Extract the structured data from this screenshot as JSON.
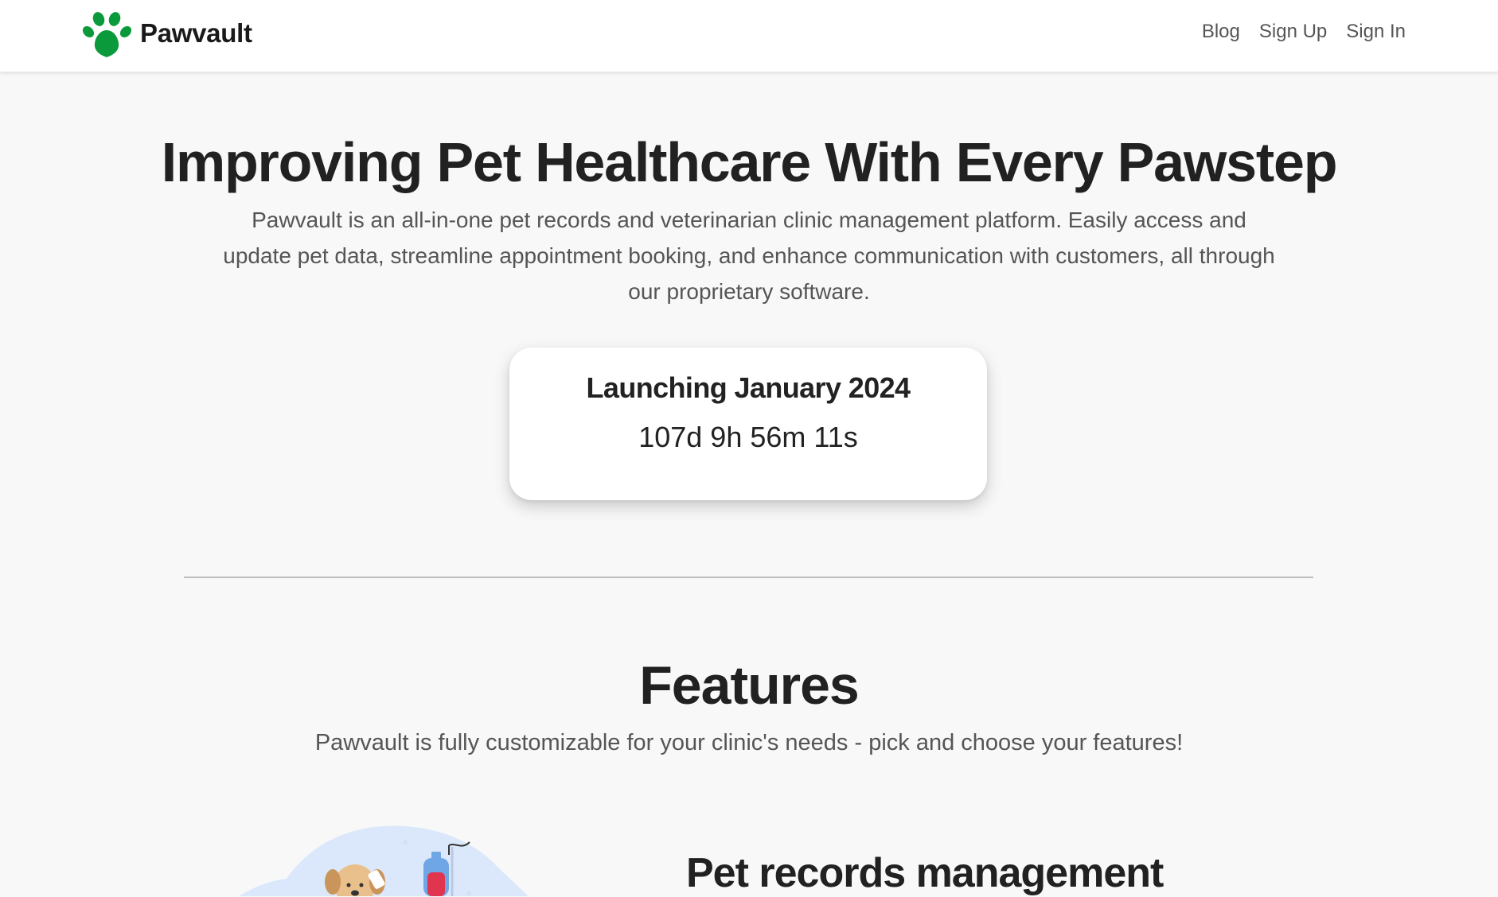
{
  "brand": {
    "name": "Pawvault",
    "logo_icon": "paw-icon",
    "accent_color": "#0a9a3c"
  },
  "nav": {
    "links": [
      "Blog",
      "Sign Up",
      "Sign In"
    ]
  },
  "hero": {
    "title": "Improving Pet Healthcare With Every Pawstep",
    "subtitle": "Pawvault is an all-in-one pet records and veterinarian clinic management platform. Easily access and update pet data, streamline appointment booking, and enhance communication with customers, all through our proprietary software."
  },
  "countdown": {
    "title": "Launching January 2024",
    "timer": "107d 9h 56m 11s"
  },
  "features": {
    "title": "Features",
    "subtitle": "Pawvault is fully customizable for your clinic's needs - pick and choose your features!",
    "items": [
      {
        "heading": "Pet records management",
        "illustration": "vet-dog-illustration"
      }
    ]
  }
}
